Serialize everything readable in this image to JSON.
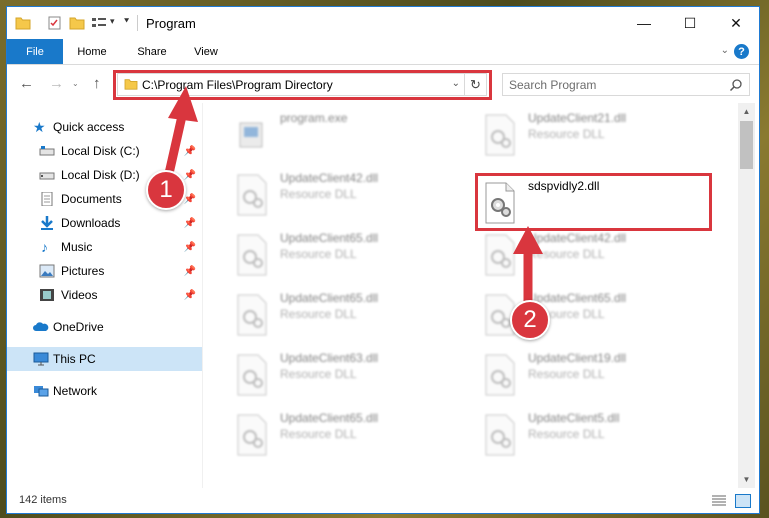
{
  "window": {
    "title": "Program"
  },
  "ribbon": {
    "tabs": [
      "File",
      "Home",
      "Share",
      "View"
    ],
    "help": "?"
  },
  "navigation": {
    "address_path": "C:\\Program Files\\Program Directory",
    "search_placeholder": "Search Program"
  },
  "sidebar": {
    "items": [
      {
        "label": "Quick access",
        "icon": "star-icon",
        "pinned": false
      },
      {
        "label": "Local Disk (C:)",
        "icon": "drive-icon",
        "pinned": true
      },
      {
        "label": "Local Disk (D:)",
        "icon": "drive-icon",
        "pinned": true
      },
      {
        "label": "Documents",
        "icon": "documents-icon",
        "pinned": true
      },
      {
        "label": "Downloads",
        "icon": "download-icon",
        "pinned": true
      },
      {
        "label": "Music",
        "icon": "music-icon",
        "pinned": true
      },
      {
        "label": "Pictures",
        "icon": "pictures-icon",
        "pinned": true
      },
      {
        "label": "Videos",
        "icon": "videos-icon",
        "pinned": true
      },
      {
        "label": "OneDrive",
        "icon": "cloud-icon",
        "pinned": false
      },
      {
        "label": "This PC",
        "icon": "computer-icon",
        "pinned": false,
        "selected": true
      },
      {
        "label": "Network",
        "icon": "network-icon",
        "pinned": false
      }
    ]
  },
  "files": {
    "left_column": [
      {
        "name": "program.exe",
        "type": ""
      },
      {
        "name": "UpdateClient42.dll",
        "type": "Resource DLL"
      },
      {
        "name": "UpdateClient65.dll",
        "type": "Resource DLL"
      },
      {
        "name": "UpdateClient65.dll",
        "type": "Resource DLL"
      },
      {
        "name": "UpdateClient63.dll",
        "type": "Resource DLL"
      },
      {
        "name": "UpdateClient65.dll",
        "type": "Resource DLL"
      }
    ],
    "right_column": [
      {
        "name": "UpdateClient21.dll",
        "type": "Resource DLL"
      },
      {
        "name": "sdspvidly2.dll",
        "type": "",
        "highlighted": true
      },
      {
        "name": "UpdateClient42.dll",
        "type": "Resource DLL"
      },
      {
        "name": "UpdateClient65.dll",
        "type": "Resource DLL"
      },
      {
        "name": "UpdateClient19.dll",
        "type": "Resource DLL"
      },
      {
        "name": "UpdateClient5.dll",
        "type": "Resource DLL"
      }
    ]
  },
  "status": {
    "item_count": "142 items"
  },
  "annotations": {
    "badge_1": "1",
    "badge_2": "2",
    "color": "#d9363e"
  },
  "colors": {
    "accent": "#1979ca",
    "selection": "#cce4f7"
  }
}
